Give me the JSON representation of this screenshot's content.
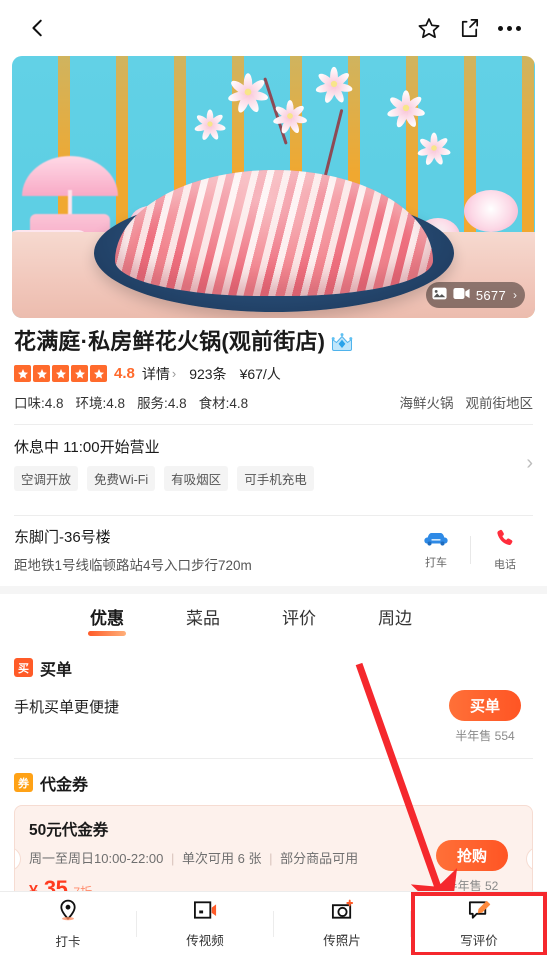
{
  "header": {
    "back_icon": "chevron-left-icon",
    "favorite_icon": "star-outline-icon",
    "share_icon": "share-icon",
    "more_icon": "more-dots-icon"
  },
  "hero": {
    "media_badge": {
      "photo_icon": "image-icon",
      "video_icon": "video-icon",
      "count": "5677",
      "chevron": "›"
    }
  },
  "shop": {
    "name": "花满庭·私房鲜花火锅(观前街店)",
    "badge_icon": "crown-badge-icon",
    "rating": {
      "stars": 5,
      "score": "4.8",
      "detail_label": "详情",
      "detail_chevron": "›",
      "review_count": "923条",
      "price_per_person": "¥67/人"
    },
    "scores": [
      "口味:4.8",
      "环境:4.8",
      "服务:4.8",
      "食材:4.8"
    ],
    "categories": [
      "海鲜火锅",
      "观前街地区"
    ]
  },
  "hours": {
    "status_text": "休息中 11:00开始营业",
    "tags": [
      "空调开放",
      "免费Wi-Fi",
      "有吸烟区",
      "可手机充电"
    ],
    "chevron": "›"
  },
  "address": {
    "line1": "东脚门-36号楼",
    "line2": "距地铁1号线临顿路站4号入口步行720m",
    "actions": [
      {
        "icon": "taxi-car-icon",
        "label": "打车"
      },
      {
        "icon": "phone-icon",
        "label": "电话"
      }
    ]
  },
  "tabs": [
    {
      "label": "优惠",
      "active": true
    },
    {
      "label": "菜品",
      "active": false
    },
    {
      "label": "评价",
      "active": false
    },
    {
      "label": "周边",
      "active": false
    }
  ],
  "deals": {
    "buy_bill": {
      "badge": "买",
      "title": "买单",
      "description": "手机买单更便捷",
      "cta": "买单",
      "sold_label": "半年售",
      "sold_count": "554"
    },
    "voucher": {
      "badge": "券",
      "title": "代金券",
      "item": {
        "name": "50元代金券",
        "rule_time": "周一至周日10:00-22:00",
        "rule_limit": "单次可用 6 张",
        "rule_scope": "部分商品可用",
        "currency": "¥",
        "price": "35",
        "discount": "7折",
        "cta": "抢购",
        "sold_label": "半年售",
        "sold_count": "52"
      }
    }
  },
  "bottom_nav": [
    {
      "icon": "location-pin-icon",
      "label": "打卡",
      "highlighted": false
    },
    {
      "icon": "upload-video-icon",
      "label": "传视频",
      "highlighted": false
    },
    {
      "icon": "upload-photo-icon",
      "label": "传照片",
      "highlighted": false
    },
    {
      "icon": "write-review-icon",
      "label": "写评价",
      "highlighted": true
    }
  ],
  "annotation": {
    "arrow_color": "#f5282d",
    "highlight_color": "#f5282d"
  },
  "colors": {
    "accent_orange": "#ff5b28",
    "voucher_red": "#ff3b1f",
    "badge_yellow": "#ffa216"
  }
}
